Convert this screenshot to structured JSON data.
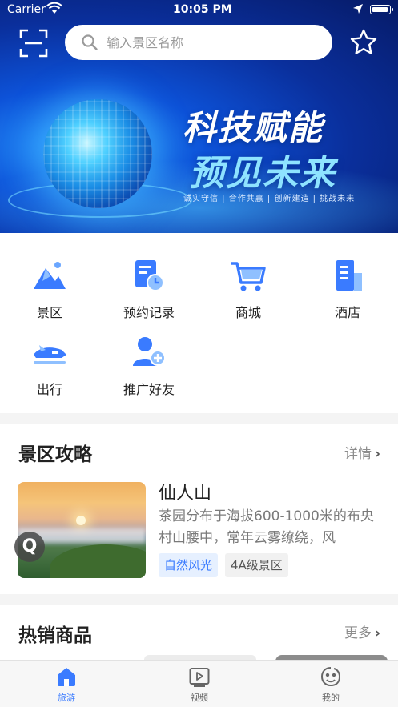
{
  "status_bar": {
    "carrier": "Carrier",
    "time": "10:05 PM"
  },
  "search": {
    "placeholder": "输入景区名称"
  },
  "banner": {
    "headline_1": "科技赋能",
    "headline_2": "预见未来",
    "slogan": "诚实守信 | 合作共赢 | 创新建造 | 挑战未来"
  },
  "menu": {
    "items": [
      {
        "label": "景区",
        "icon": "mountain-icon"
      },
      {
        "label": "预约记录",
        "icon": "document-clock-icon"
      },
      {
        "label": "商城",
        "icon": "shopping-cart-icon"
      },
      {
        "label": "酒店",
        "icon": "building-icon"
      },
      {
        "label": "出行",
        "icon": "train-icon"
      },
      {
        "label": "推广好友",
        "icon": "add-user-icon"
      }
    ]
  },
  "guide": {
    "title": "景区攻略",
    "more_label": "详情",
    "spot": {
      "name": "仙人山",
      "description": "茶园分布于海拔600-1000米的布央村山腰中，常年云雾缭绕，风",
      "tags": [
        "自然风光",
        "4A级景区"
      ]
    }
  },
  "hot_goods": {
    "title": "热销商品",
    "more_label": "更多"
  },
  "tabbar": {
    "tabs": [
      {
        "label": "旅游",
        "icon": "home-icon",
        "active": true
      },
      {
        "label": "视频",
        "icon": "video-play-icon",
        "active": false
      },
      {
        "label": "我的",
        "icon": "face-icon",
        "active": false
      }
    ]
  },
  "colors": {
    "accent": "#3a7bff",
    "hero_blue": "#0d52d8",
    "tag_blue_bg": "#e6f0ff"
  }
}
